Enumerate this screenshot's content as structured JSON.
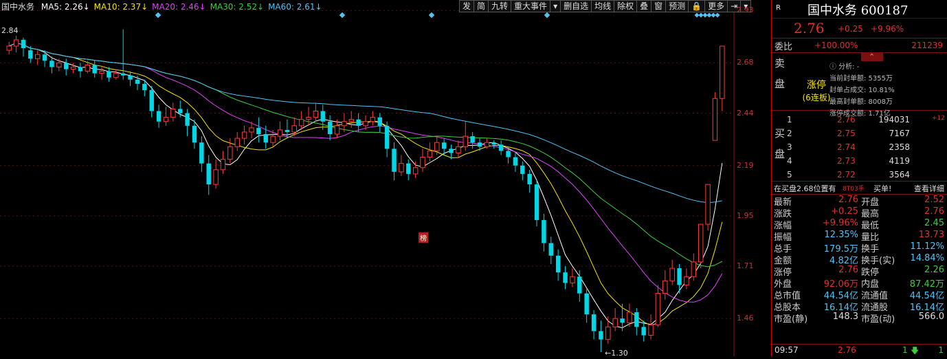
{
  "chart": {
    "stock_short": "国中水务",
    "ma": [
      {
        "label": "MA5: 2.26",
        "color": "#ffffff"
      },
      {
        "label": "MA10: 2.37",
        "color": "#f7e300"
      },
      {
        "label": "MA20: 2.46",
        "color": "#e040fb"
      },
      {
        "label": "MA30: 2.52",
        "color": "#3ccf3c"
      },
      {
        "label": "MA60: 2.61",
        "color": "#4fc3f7"
      }
    ],
    "toolbar": [
      "发",
      "简",
      "九转",
      "重大事件",
      "▾",
      "删自选",
      "均线",
      "除权",
      "叠",
      "窗",
      "预测",
      "🔒",
      "更多",
      "⇥",
      "▾"
    ],
    "price_axis": [
      "2.93",
      "2.68",
      "2.44",
      "2.19",
      "1.95",
      "1.71",
      "1.46"
    ],
    "high_label": "2.84",
    "low_label": "1.30",
    "bang_label": "榜"
  },
  "chart_data": {
    "type": "candlestick",
    "ylim": [
      1.28,
      2.98
    ],
    "grid": true,
    "candles": [
      [
        2.74,
        2.76,
        2.78,
        2.72
      ],
      [
        2.76,
        2.79,
        2.81,
        2.73
      ],
      [
        2.79,
        2.75,
        2.8,
        2.71
      ],
      [
        2.74,
        2.7,
        2.76,
        2.68
      ],
      [
        2.7,
        2.72,
        2.74,
        2.67
      ],
      [
        2.72,
        2.69,
        2.74,
        2.66
      ],
      [
        2.69,
        2.66,
        2.71,
        2.63
      ],
      [
        2.66,
        2.68,
        2.7,
        2.64
      ],
      [
        2.68,
        2.65,
        2.7,
        2.62
      ],
      [
        2.65,
        2.66,
        2.68,
        2.63
      ],
      [
        2.66,
        2.64,
        2.68,
        2.61
      ],
      [
        2.64,
        2.67,
        2.69,
        2.63
      ],
      [
        2.67,
        2.63,
        2.69,
        2.61
      ],
      [
        2.63,
        2.64,
        2.66,
        2.6
      ],
      [
        2.64,
        2.61,
        2.66,
        2.59
      ],
      [
        2.61,
        2.63,
        2.65,
        2.6
      ],
      [
        2.63,
        2.62,
        2.84,
        2.6
      ],
      [
        2.62,
        2.6,
        2.64,
        2.57
      ],
      [
        2.6,
        2.58,
        2.62,
        2.55
      ],
      [
        2.58,
        2.55,
        2.6,
        2.52
      ],
      [
        2.55,
        2.45,
        2.57,
        2.42
      ],
      [
        2.45,
        2.4,
        2.48,
        2.37
      ],
      [
        2.4,
        2.42,
        2.47,
        2.38
      ],
      [
        2.42,
        2.46,
        2.49,
        2.4
      ],
      [
        2.46,
        2.44,
        2.5,
        2.42
      ],
      [
        2.44,
        2.38,
        2.46,
        2.33
      ],
      [
        2.38,
        2.3,
        2.41,
        2.27
      ],
      [
        2.3,
        2.2,
        2.33,
        2.16
      ],
      [
        2.2,
        2.1,
        2.24,
        2.05
      ],
      [
        2.1,
        2.17,
        2.22,
        2.08
      ],
      [
        2.17,
        2.22,
        2.26,
        2.15
      ],
      [
        2.22,
        2.28,
        2.32,
        2.2
      ],
      [
        2.28,
        2.32,
        2.35,
        2.26
      ],
      [
        2.32,
        2.35,
        2.38,
        2.29
      ],
      [
        2.35,
        2.37,
        2.4,
        2.32
      ],
      [
        2.37,
        2.34,
        2.42,
        2.3
      ],
      [
        2.34,
        2.3,
        2.38,
        2.27
      ],
      [
        2.3,
        2.33,
        2.36,
        2.28
      ],
      [
        2.33,
        2.36,
        2.4,
        2.31
      ],
      [
        2.36,
        2.35,
        2.41,
        2.32
      ],
      [
        2.35,
        2.38,
        2.42,
        2.33
      ],
      [
        2.38,
        2.41,
        2.45,
        2.36
      ],
      [
        2.41,
        2.42,
        2.47,
        2.38
      ],
      [
        2.42,
        2.45,
        2.49,
        2.4
      ],
      [
        2.45,
        2.4,
        2.48,
        2.36
      ],
      [
        2.4,
        2.34,
        2.43,
        2.31
      ],
      [
        2.34,
        2.38,
        2.41,
        2.32
      ],
      [
        2.38,
        2.4,
        2.44,
        2.35
      ],
      [
        2.4,
        2.41,
        2.45,
        2.37
      ],
      [
        2.41,
        2.38,
        2.44,
        2.35
      ],
      [
        2.38,
        2.4,
        2.43,
        2.36
      ],
      [
        2.4,
        2.42,
        2.45,
        2.38
      ],
      [
        2.42,
        2.38,
        2.44,
        2.35
      ],
      [
        2.38,
        2.27,
        2.4,
        2.23
      ],
      [
        2.27,
        2.16,
        2.3,
        2.12
      ],
      [
        2.16,
        2.2,
        2.24,
        2.14
      ],
      [
        2.2,
        2.15,
        2.22,
        2.12
      ],
      [
        2.15,
        2.18,
        2.21,
        2.13
      ],
      [
        2.18,
        2.23,
        2.27,
        2.16
      ],
      [
        2.23,
        2.26,
        2.3,
        2.21
      ],
      [
        2.26,
        2.3,
        2.33,
        2.24
      ],
      [
        2.3,
        2.27,
        2.32,
        2.24
      ],
      [
        2.27,
        2.25,
        2.29,
        2.22
      ],
      [
        2.25,
        2.28,
        2.31,
        2.23
      ],
      [
        2.28,
        2.33,
        2.4,
        2.26
      ],
      [
        2.33,
        2.3,
        2.35,
        2.27
      ],
      [
        2.3,
        2.28,
        2.32,
        2.26
      ],
      [
        2.28,
        2.3,
        2.32,
        2.27
      ],
      [
        2.3,
        2.29,
        2.31,
        2.27
      ],
      [
        2.29,
        2.26,
        2.31,
        2.24
      ],
      [
        2.26,
        2.23,
        2.28,
        2.2
      ],
      [
        2.23,
        2.19,
        2.25,
        2.16
      ],
      [
        2.19,
        2.15,
        2.21,
        2.12
      ],
      [
        2.15,
        2.1,
        2.17,
        2.06
      ],
      [
        2.1,
        1.93,
        2.12,
        1.9
      ],
      [
        1.93,
        1.82,
        1.96,
        1.78
      ],
      [
        1.82,
        1.76,
        1.85,
        1.72
      ],
      [
        1.76,
        1.68,
        1.79,
        1.64
      ],
      [
        1.68,
        1.63,
        1.71,
        1.6
      ],
      [
        1.63,
        1.66,
        1.7,
        1.61
      ],
      [
        1.66,
        1.58,
        1.69,
        1.54
      ],
      [
        1.58,
        1.48,
        1.6,
        1.44
      ],
      [
        1.48,
        1.4,
        1.5,
        1.36
      ],
      [
        1.4,
        1.36,
        1.45,
        1.3
      ],
      [
        1.36,
        1.42,
        1.47,
        1.34
      ],
      [
        1.42,
        1.46,
        1.51,
        1.4
      ],
      [
        1.46,
        1.44,
        1.53,
        1.4
      ],
      [
        1.44,
        1.49,
        1.53,
        1.42
      ],
      [
        1.49,
        1.42,
        1.51,
        1.38
      ],
      [
        1.42,
        1.38,
        1.45,
        1.35
      ],
      [
        1.38,
        1.43,
        1.48,
        1.36
      ],
      [
        1.43,
        1.58,
        1.62,
        1.42
      ],
      [
        1.58,
        1.64,
        1.69,
        1.55
      ],
      [
        1.64,
        1.7,
        1.74,
        1.62
      ],
      [
        1.7,
        1.62,
        1.72,
        1.58
      ],
      [
        1.62,
        1.66,
        1.7,
        1.6
      ],
      [
        1.66,
        1.73,
        1.77,
        1.64
      ],
      [
        1.73,
        1.91,
        1.91,
        1.7
      ],
      [
        1.91,
        2.1,
        2.1,
        1.88
      ],
      [
        2.31,
        2.51,
        2.54,
        2.31
      ],
      [
        2.51,
        2.76,
        2.76,
        2.45
      ]
    ]
  },
  "panel": {
    "badge": "R",
    "name_code": "国中水务 600187",
    "price": "2.76",
    "change": "+0.25",
    "change_pct": "+9.96%",
    "wei_label": "委比",
    "wei_pct": "+100.00%",
    "wei_val": "211239",
    "sell_label": "卖盘",
    "analysis": "ⓘ 分析: -",
    "limit_up": "涨停",
    "limit_streak": "(6连板)",
    "info": [
      "当前封单额: 5355万",
      "封单占成交: 10.81%",
      "最高封单额: 8008万",
      "涨停成交额: 1.71亿"
    ],
    "buy_label": "买盘",
    "buy": [
      {
        "lv": "1",
        "price": "2.76",
        "qty": "194031",
        "inc": "+12"
      },
      {
        "lv": "2",
        "price": "2.75",
        "qty": "7167",
        "inc": ""
      },
      {
        "lv": "3",
        "price": "2.74",
        "qty": "2358",
        "inc": ""
      },
      {
        "lv": "4",
        "price": "2.73",
        "qty": "4119",
        "inc": ""
      },
      {
        "lv": "5",
        "price": "2.72",
        "qty": "3564",
        "inc": ""
      }
    ],
    "notice_a": "在买盘2.68位置有",
    "notice_b": "8T03手",
    "notice_c": "买单!",
    "notice_d": "查看详细",
    "stats": [
      {
        "k1": "最新",
        "v1": "2.76",
        "c1": "red",
        "k2": "开盘",
        "v2": "2.52",
        "c2": "red"
      },
      {
        "k1": "涨跌",
        "v1": "+0.25",
        "c1": "red",
        "k2": "最高",
        "v2": "2.76",
        "c2": "red"
      },
      {
        "k1": "涨幅",
        "v1": "+9.96%",
        "c1": "red",
        "k2": "最低",
        "v2": "2.45",
        "c2": "green"
      },
      {
        "k1": "振幅",
        "v1": "12.35%",
        "c1": "cyan",
        "k2": "量比",
        "v2": "13.73",
        "c2": "red"
      },
      {
        "k1": "总手",
        "v1": "179.5万",
        "c1": "cyan",
        "k2": "换手",
        "v2": "11.12%",
        "c2": "cyan"
      },
      {
        "k1": "金额",
        "v1": "4.82亿",
        "c1": "cyan",
        "k2": "换手(实)",
        "v2": "14.84%",
        "c2": "cyan"
      },
      {
        "k1": "涨停",
        "v1": "2.76",
        "c1": "red",
        "k2": "跌停",
        "v2": "2.26",
        "c2": "green"
      },
      {
        "k1": "外盘",
        "v1": "92.06万",
        "c1": "red",
        "k2": "内盘",
        "v2": "87.42万",
        "c2": "green"
      },
      {
        "k1": "总市值",
        "v1": "44.54亿",
        "c1": "cyan",
        "k2": "流通值",
        "v2": "44.54亿",
        "c2": "cyan"
      },
      {
        "k1": "总股本",
        "v1": "16.14亿",
        "c1": "cyan",
        "k2": "流通股",
        "v2": "16.14亿",
        "c2": "cyan"
      },
      {
        "k1": "市盈(静)",
        "v1": "148.3",
        "c1": "white",
        "k2": "市盈(动)",
        "v2": "566.0",
        "c2": "white"
      }
    ],
    "bottom_time": "09:57",
    "bottom_price": "2.76",
    "bottom_vol": "1",
    "bottom_num": "1"
  }
}
